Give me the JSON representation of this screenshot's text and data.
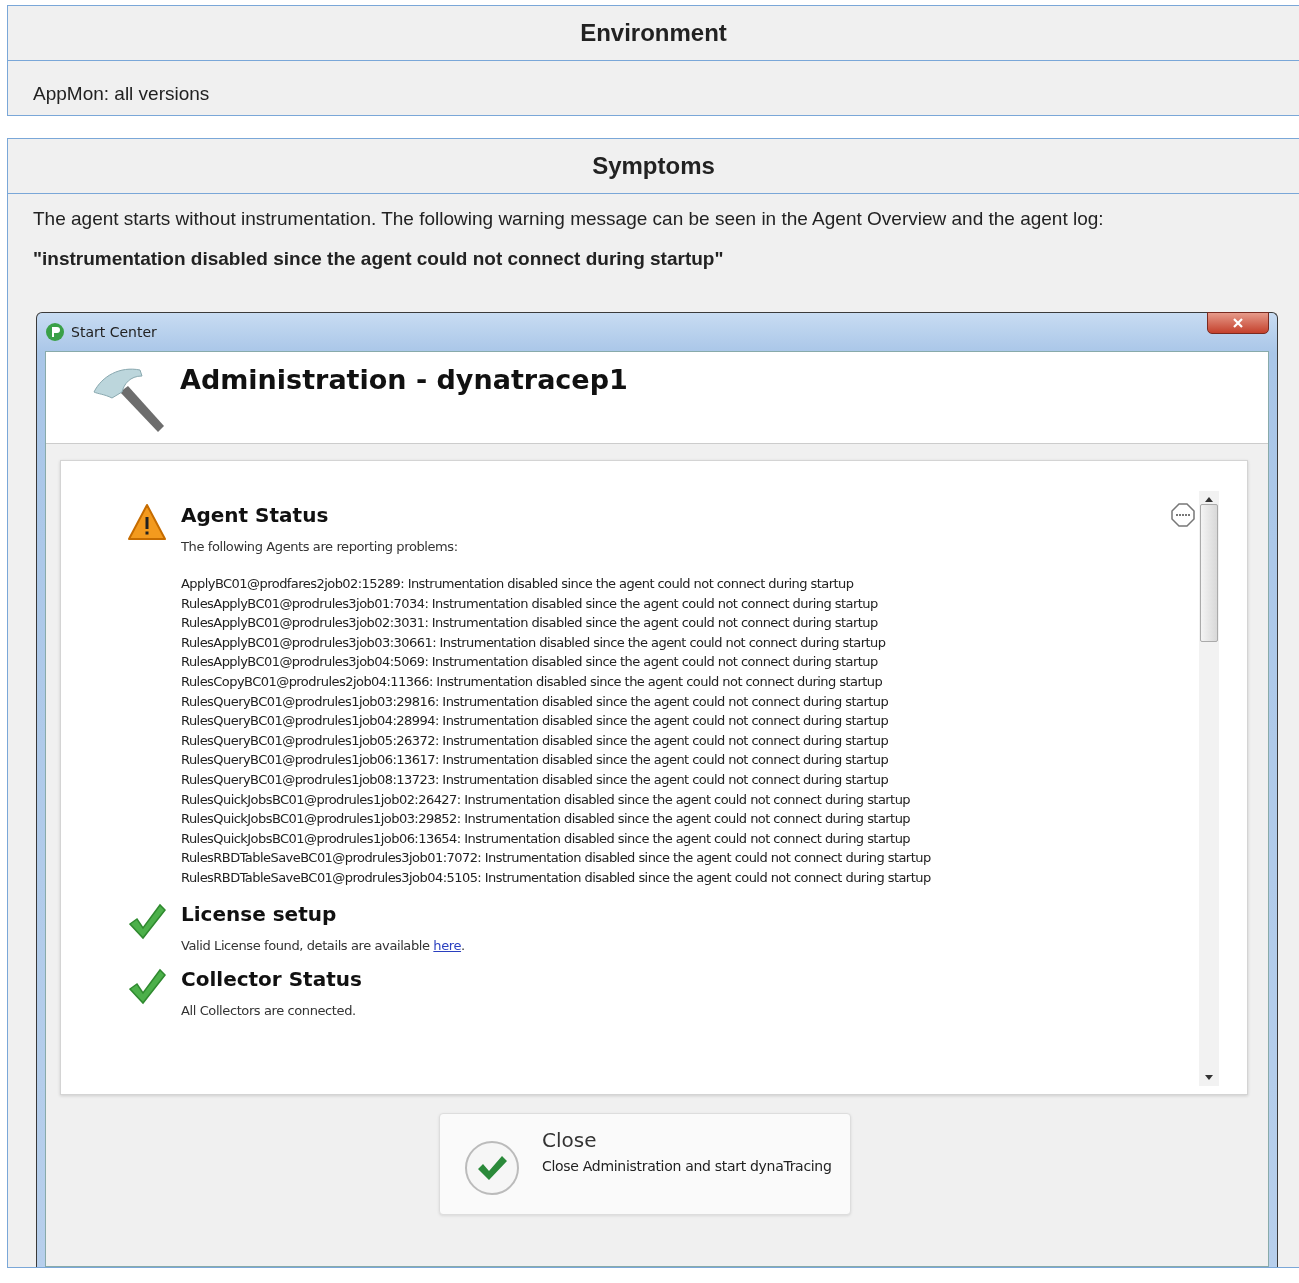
{
  "sections": [
    {
      "title": "Environment",
      "kind": "text",
      "paragraphs": [
        {
          "text": "AppMon: all versions",
          "bold": false
        }
      ]
    },
    {
      "title": "Symptoms",
      "kind": "screenshot",
      "paragraphs": [
        {
          "text": "The agent  starts without instrumentation. The following warning message can be seen in the Agent Overview and the agent log:",
          "bold": false
        },
        {
          "text": "\"instrumentation disabled since the agent could not connect during startup\"",
          "bold": true
        }
      ]
    }
  ],
  "window": {
    "title": "Start Center",
    "heading": "Administration - dynatracep1",
    "statuses": [
      {
        "kind": "warning",
        "title": "Agent Status",
        "intro": "The following Agents are reporting problems:",
        "lines": [
          "ApplyBC01@prodfares2job02:15289: Instrumentation disabled since the agent could not connect during startup",
          "RulesApplyBC01@prodrules3job01:7034: Instrumentation disabled since the agent could not connect during startup",
          "RulesApplyBC01@prodrules3job02:3031: Instrumentation disabled since the agent could not connect during startup",
          "RulesApplyBC01@prodrules3job03:30661: Instrumentation disabled since the agent could not connect during startup",
          "RulesApplyBC01@prodrules3job04:5069: Instrumentation disabled since the agent could not connect during startup",
          "RulesCopyBC01@prodrules2job04:11366: Instrumentation disabled since the agent could not connect during startup",
          "RulesQueryBC01@prodrules1job03:29816: Instrumentation disabled since the agent could not connect during startup",
          "RulesQueryBC01@prodrules1job04:28994: Instrumentation disabled since the agent could not connect during startup",
          "RulesQueryBC01@prodrules1job05:26372: Instrumentation disabled since the agent could not connect during startup",
          "RulesQueryBC01@prodrules1job06:13617: Instrumentation disabled since the agent could not connect during startup",
          "RulesQueryBC01@prodrules1job08:13723: Instrumentation disabled since the agent could not connect during startup",
          "RulesQuickJobsBC01@prodrules1job02:26427: Instrumentation disabled since the agent could not connect during startup",
          "RulesQuickJobsBC01@prodrules1job03:29852: Instrumentation disabled since the agent could not connect during startup",
          "RulesQuickJobsBC01@prodrules1job06:13654: Instrumentation disabled since the agent could not connect during startup",
          "RulesRBDTableSaveBC01@prodrules3job01:7072: Instrumentation disabled since the agent could not connect during startup",
          "RulesRBDTableSaveBC01@prodrules3job04:5105: Instrumentation disabled since the agent could not connect during startup"
        ]
      },
      {
        "kind": "ok",
        "title": "License setup",
        "intro": "Valid License found, details are available ",
        "link": "here",
        "suffix": "."
      },
      {
        "kind": "ok",
        "title": "Collector Status",
        "intro": "All Collectors are connected."
      }
    ],
    "button": {
      "title": "Close",
      "subtitle": "Close Administration and start dynaTracing"
    }
  }
}
